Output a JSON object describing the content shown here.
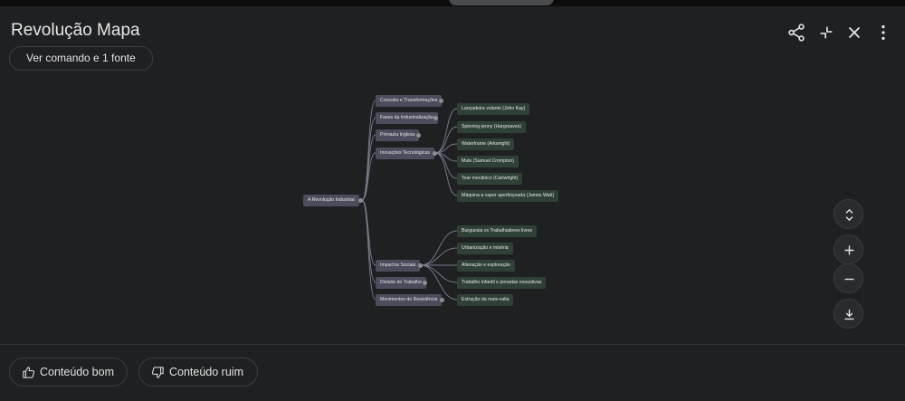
{
  "header": {
    "title": "Revolução Mapa",
    "source_button": "Ver comando e 1 fonte"
  },
  "icons": {
    "share": "share-icon",
    "collapse": "collapse-icon",
    "close": "close-icon",
    "more": "more-vert-icon",
    "expand_collapse": "unfold-icon",
    "zoom_in": "plus-icon",
    "zoom_out": "minus-icon",
    "download": "download-icon"
  },
  "mindmap": {
    "root": "A Revolução Industrial",
    "branches": [
      "Conceito e Transformações",
      "Fases da Industrialização",
      "Primazia Inglesa",
      "Inovações Tecnológicas",
      "Impactos Sociais",
      "Divisão do Trabalho",
      "Movimentos de Resistência"
    ],
    "innovations": [
      "Lançadeira volante (John Kay)",
      "Spinning-jenny (Hargreaves)",
      "Waterframe (Arkwright)",
      "Mule (Samuel Crompton)",
      "Tear mecânico (Cartwright)",
      "Máquina a vapor aperfeiçoada (James Watt)"
    ],
    "social_impacts": [
      "Burguesia vs Trabalhadores livres",
      "Urbanização e miséria",
      "Alienação e exploração",
      "Trabalho infantil e jornadas exaustivas",
      "Extração da mais-valia"
    ]
  },
  "feedback": {
    "good": "Conteúdo bom",
    "bad": "Conteúdo ruim"
  },
  "colors": {
    "background": "#1f2022",
    "node_primary": "#4b4c5c",
    "node_leaf": "#2f4137",
    "link": "#7b7c8c"
  }
}
